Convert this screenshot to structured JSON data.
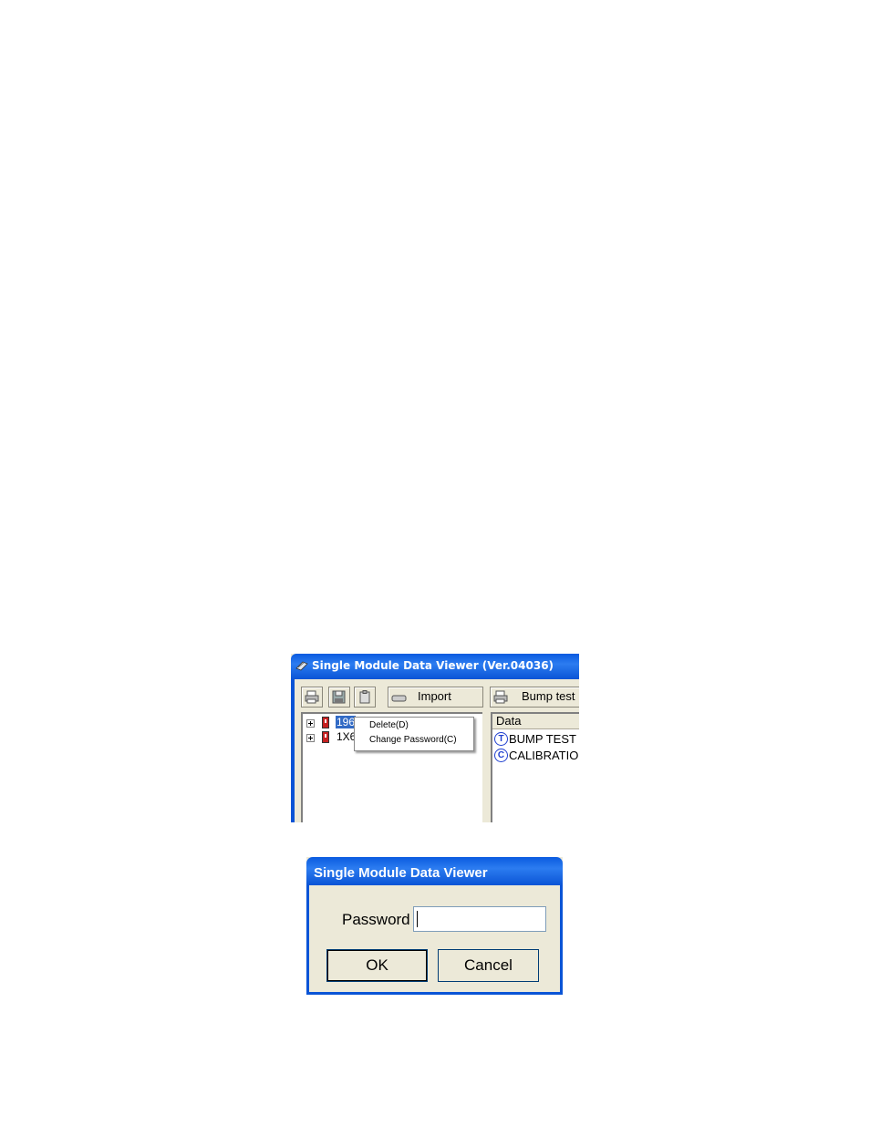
{
  "app_window": {
    "title": "Single Module Data Viewer (Ver.04036)",
    "toolbar": {
      "import_label": "Import",
      "bump_test_label": "Bump test"
    },
    "tree": {
      "items": [
        {
          "label": "196",
          "selected": true
        },
        {
          "label": "1X6",
          "selected": false
        }
      ]
    },
    "context_menu": {
      "items": [
        {
          "label": "Delete(D)"
        },
        {
          "label": "Change Password(C)"
        }
      ]
    },
    "data_panel": {
      "header": "Data",
      "rows": [
        {
          "icon_letter": "T",
          "label": "BUMP TEST"
        },
        {
          "icon_letter": "C",
          "label": "CALIBRATION"
        }
      ]
    }
  },
  "password_dialog": {
    "title": "Single Module Data Viewer",
    "password_label": "Password",
    "password_value": "",
    "ok_label": "OK",
    "cancel_label": "Cancel"
  },
  "colors": {
    "titlebar": "#0a5be0",
    "selection": "#316ac5",
    "window_bg": "#ece9d8",
    "icon_blue": "#1f3fd0"
  }
}
